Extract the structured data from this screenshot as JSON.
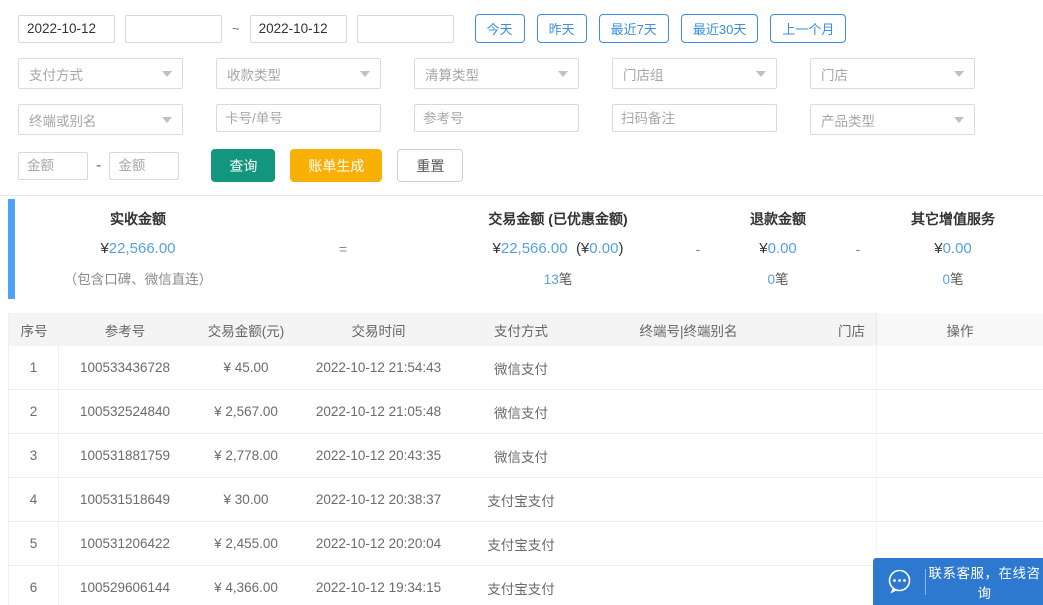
{
  "colors": {
    "accent_blue": "#3A8EE6",
    "value_blue": "#55A1E4",
    "summary_bar_blue": "#4DA3F5",
    "query_teal": "#13967E",
    "bill_orange": "#F9B006",
    "chat_blue": "#2E79D0"
  },
  "filters": {
    "date_start": "2022-10-12",
    "date_end": "2022-10-12",
    "range_separator": "~",
    "quick_buttons": [
      "今天",
      "昨天",
      "最近7天",
      "最近30天",
      "上一个月"
    ],
    "row2": [
      {
        "type": "select",
        "label": "支付方式"
      },
      {
        "type": "select",
        "label": "收款类型"
      },
      {
        "type": "select",
        "label": "清算类型"
      },
      {
        "type": "select",
        "label": "门店组"
      },
      {
        "type": "select",
        "label": "门店"
      }
    ],
    "row3": [
      {
        "type": "select",
        "label": "终端或别名"
      },
      {
        "type": "input",
        "label": "卡号/单号"
      },
      {
        "type": "input",
        "label": "参考号"
      },
      {
        "type": "input",
        "label": "扫码备注"
      },
      {
        "type": "select",
        "label": "产品类型"
      }
    ],
    "amount_min_placeholder": "金额",
    "amount_max_placeholder": "金额",
    "amount_separator": "-",
    "query_label": "查询",
    "bill_label": "账单生成",
    "reset_label": "重置"
  },
  "summary": {
    "received": {
      "label": "实收金额",
      "yen": "¥",
      "amount": "22,566.00",
      "note": "（包含口碑、微信直连）"
    },
    "equals": "=",
    "trade": {
      "label": "交易金额 (已优惠金额)",
      "yen": "¥",
      "amount": "22,566.00",
      "discount_open": "(¥",
      "discount_amount": "0.00",
      "discount_close": ")",
      "count": "13",
      "unit": "笔"
    },
    "minus1": "-",
    "refund": {
      "label": "退款金额",
      "yen": "¥",
      "amount": "0.00",
      "count": "0",
      "unit": "笔"
    },
    "minus2": "-",
    "vas": {
      "label": "其它增值服务",
      "yen": "¥",
      "amount": "0.00",
      "count": "0",
      "unit": "笔"
    }
  },
  "table": {
    "headers": [
      "序号",
      "参考号",
      "交易金额(元)",
      "交易时间",
      "支付方式",
      "终端号|终端别名",
      "门店",
      "操作"
    ],
    "rows": [
      [
        "1",
        "100533436728",
        "¥ 45.00",
        "2022-10-12 21:54:43",
        "微信支付"
      ],
      [
        "2",
        "100532524840",
        "¥ 2,567.00",
        "2022-10-12 21:05:48",
        "微信支付"
      ],
      [
        "3",
        "100531881759",
        "¥ 2,778.00",
        "2022-10-12 20:43:35",
        "微信支付"
      ],
      [
        "4",
        "100531518649",
        "¥ 30.00",
        "2022-10-12 20:38:37",
        "支付宝支付"
      ],
      [
        "5",
        "100531206422",
        "¥ 2,455.00",
        "2022-10-12 20:20:04",
        "支付宝支付"
      ],
      [
        "6",
        "100529606144",
        "¥ 4,366.00",
        "2022-10-12 19:34:15",
        "支付宝支付"
      ]
    ]
  },
  "chat": {
    "label": "联系客服，在线咨询"
  }
}
